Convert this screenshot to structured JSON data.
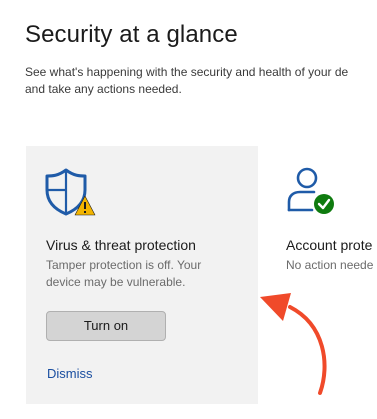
{
  "header": {
    "title": "Security at a glance",
    "subtitle_line1": "See what's happening with the security and health of your de",
    "subtitle_line2": "and take any actions needed."
  },
  "cards": {
    "virus": {
      "icon": "shield-warning-icon",
      "title": "Virus & threat protection",
      "desc_line1": "Tamper protection is off. Your",
      "desc_line2": "device may be vulnerable.",
      "action_label": "Turn on",
      "dismiss_label": "Dismiss"
    },
    "account": {
      "icon": "person-check-icon",
      "title": "Account prote",
      "desc": "No action neede"
    }
  },
  "annotation": {
    "icon": "red-arrow-icon"
  },
  "colors": {
    "accent": "#1a4ea0",
    "shield": "#1f5ba8",
    "warning": "#f2b400",
    "success": "#0f7b0f",
    "arrow": "#f04a2a"
  }
}
